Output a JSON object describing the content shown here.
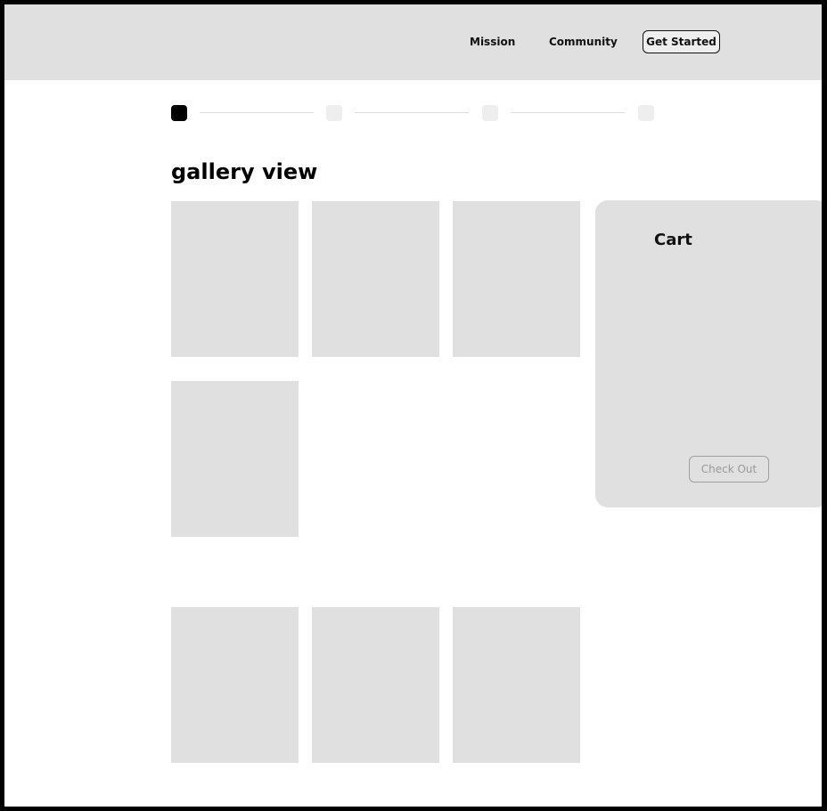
{
  "nav": {
    "links": [
      "Mission",
      "Community"
    ],
    "cta_label": "Get Started"
  },
  "stepper": {
    "total_steps": 4,
    "current_step": 1
  },
  "main": {
    "title": "gallery view",
    "gallery_tile_count": 7
  },
  "cart": {
    "title": "Cart",
    "checkout_label": "Check Out"
  },
  "colors": {
    "placeholder": "#e0e0e0",
    "active_step": "#000000",
    "inactive_step": "#eeeeee",
    "text": "#111111",
    "disabled_text": "#999999"
  }
}
